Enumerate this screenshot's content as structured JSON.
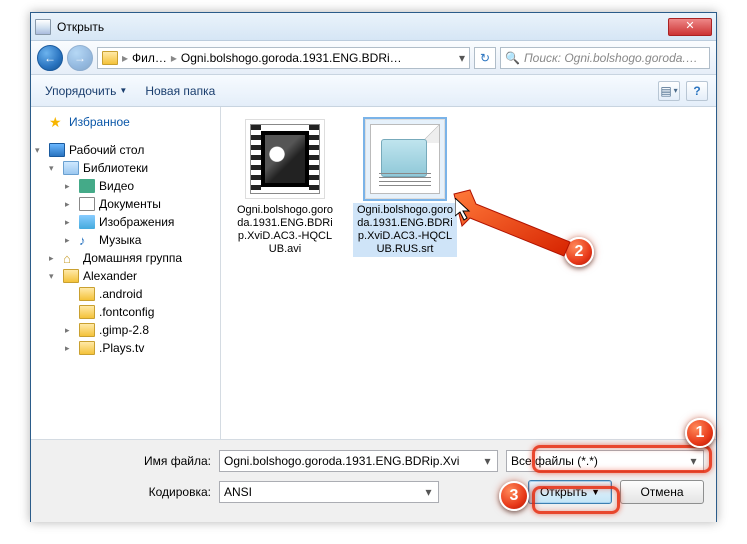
{
  "window": {
    "title": "Открыть",
    "close": "✕"
  },
  "nav": {
    "back": "←",
    "fwd": "→",
    "crumb1": "Фил…",
    "crumb2": "Ogni.bolshogo.goroda.1931.ENG.BDRi…",
    "search_placeholder": "Поиск: Ogni.bolshogo.goroda.…"
  },
  "toolbar": {
    "organize": "Упорядочить",
    "newfolder": "Новая папка"
  },
  "tree": {
    "favorites": "Избранное",
    "desktop": "Рабочий стол",
    "libraries": "Библиотеки",
    "video": "Видео",
    "documents": "Документы",
    "images": "Изображения",
    "music": "Музыка",
    "homegroup": "Домашняя группа",
    "user": "Alexander",
    "f1": ".android",
    "f2": ".fontconfig",
    "f3": ".gimp-2.8",
    "f4": ".Plays.tv"
  },
  "files": {
    "avi": "Ogni.bolshogo.goroda.1931.ENG.BDRip.XviD.AC3.-HQCLUB.avi",
    "srt": "Ogni.bolshogo.goroda.1931.ENG.BDRip.XviD.AC3.-HQCLUB.RUS.srt"
  },
  "footer": {
    "filename_label": "Имя файла:",
    "filename_value": "Ogni.bolshogo.goroda.1931.ENG.BDRip.Xvi",
    "encoding_label": "Кодировка:",
    "encoding_value": "ANSI",
    "filetype": "Все файлы  (*.*)",
    "open": "Открыть",
    "cancel": "Отмена"
  },
  "callouts": {
    "c1": "1",
    "c2": "2",
    "c3": "3"
  }
}
